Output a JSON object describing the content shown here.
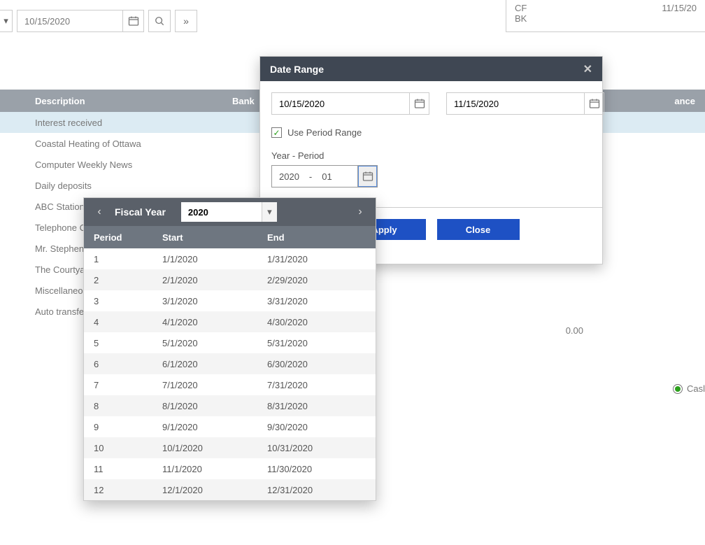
{
  "toolbar": {
    "date_value": "10/15/2020"
  },
  "info": {
    "lines": [
      "CF",
      "BK"
    ],
    "right": "11/15/20"
  },
  "table": {
    "headers": {
      "desc": "Description",
      "bank": "Bank",
      "bal": "ance"
    },
    "rows": [
      "Interest received",
      "Coastal Heating of Ottawa",
      "Computer Weekly News",
      "Daily deposits",
      "ABC Statione",
      "Telephone C",
      "Mr. Stephen",
      "The Courtya",
      "Miscellaneou",
      "Auto transfer"
    ],
    "total": "0.00"
  },
  "radio": {
    "label": "Casl"
  },
  "modal": {
    "title": "Date Range",
    "from": "10/15/2020",
    "to": "11/15/2020",
    "use_period": "Use Period Range",
    "yp_label": "Year - Period",
    "year": "2020",
    "period": "01",
    "apply": "Apply",
    "close": "Close"
  },
  "fy": {
    "label": "Fiscal Year",
    "year": "2020",
    "headers": {
      "p": "Period",
      "s": "Start",
      "e": "End"
    },
    "rows": [
      {
        "p": "1",
        "s": "1/1/2020",
        "e": "1/31/2020"
      },
      {
        "p": "2",
        "s": "2/1/2020",
        "e": "2/29/2020"
      },
      {
        "p": "3",
        "s": "3/1/2020",
        "e": "3/31/2020"
      },
      {
        "p": "4",
        "s": "4/1/2020",
        "e": "4/30/2020"
      },
      {
        "p": "5",
        "s": "5/1/2020",
        "e": "5/31/2020"
      },
      {
        "p": "6",
        "s": "6/1/2020",
        "e": "6/30/2020"
      },
      {
        "p": "7",
        "s": "7/1/2020",
        "e": "7/31/2020"
      },
      {
        "p": "8",
        "s": "8/1/2020",
        "e": "8/31/2020"
      },
      {
        "p": "9",
        "s": "9/1/2020",
        "e": "9/30/2020"
      },
      {
        "p": "10",
        "s": "10/1/2020",
        "e": "10/31/2020"
      },
      {
        "p": "11",
        "s": "11/1/2020",
        "e": "11/30/2020"
      },
      {
        "p": "12",
        "s": "12/1/2020",
        "e": "12/31/2020"
      }
    ]
  }
}
